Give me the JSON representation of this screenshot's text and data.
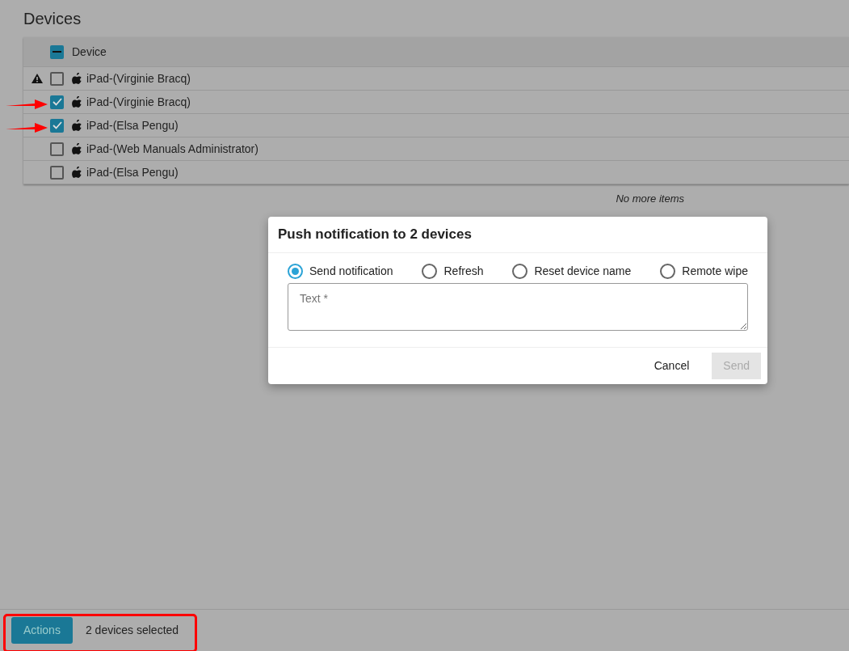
{
  "page": {
    "title": "Devices"
  },
  "table": {
    "columns": [
      {
        "label": "Device",
        "indeterminate": true
      }
    ],
    "rows": [
      {
        "device": "iPad-(Virginie Bracq)",
        "warning": true,
        "checked": false
      },
      {
        "device": "iPad-(Virginie Bracq)",
        "warning": false,
        "checked": true,
        "arrow": true
      },
      {
        "device": "iPad-(Elsa Pengu)",
        "warning": false,
        "checked": true,
        "arrow": true
      },
      {
        "device": "iPad-(Web Manuals Administrator)",
        "warning": false,
        "checked": false
      },
      {
        "device": "iPad-(Elsa Pengu)",
        "warning": false,
        "checked": false
      }
    ],
    "footer_note": "No more items"
  },
  "dialog": {
    "title": "Push notification to 2 devices",
    "options": [
      {
        "label": "Send notification",
        "selected": true
      },
      {
        "label": "Refresh",
        "selected": false
      },
      {
        "label": "Reset device name",
        "selected": false
      },
      {
        "label": "Remote wipe",
        "selected": false
      }
    ],
    "text_field": {
      "placeholder": "Text *"
    },
    "buttons": [
      {
        "label": "Cancel",
        "kind": "link",
        "disabled": false
      },
      {
        "label": "Send",
        "kind": "primary",
        "disabled": true
      }
    ]
  },
  "bottom_bar": {
    "button": "Actions",
    "status": "2 devices selected"
  },
  "annotations": {
    "highlight_bottom_bar": true
  }
}
